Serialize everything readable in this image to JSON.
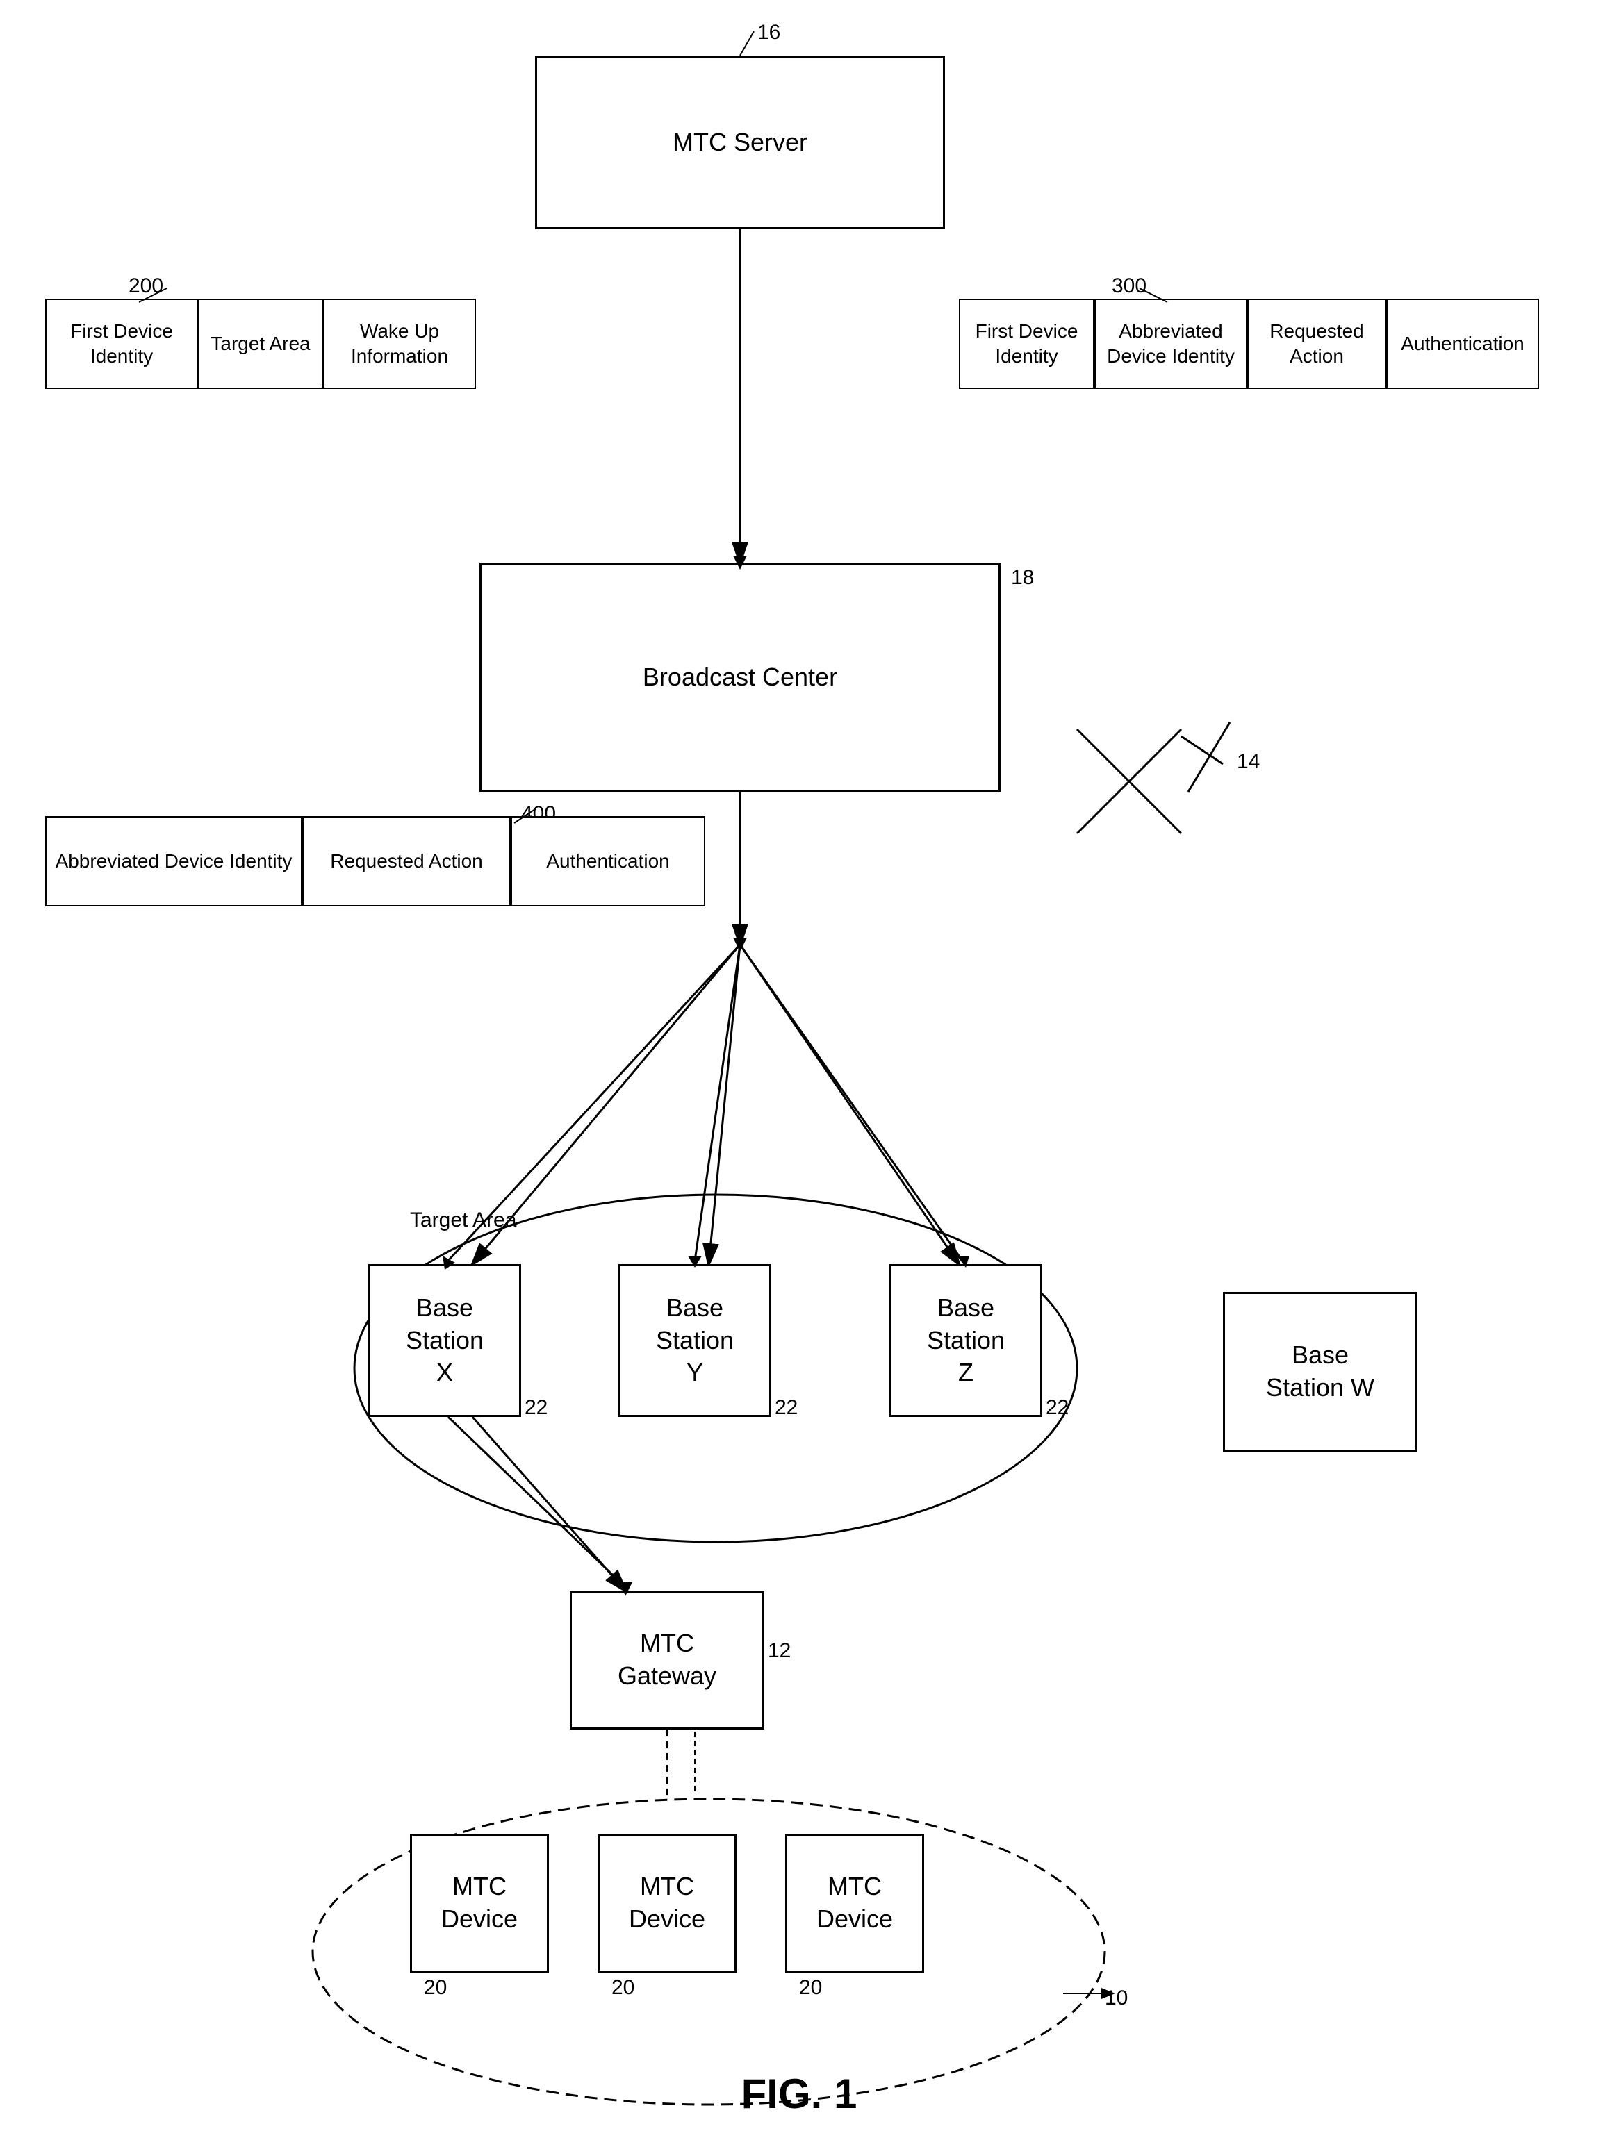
{
  "title": "FIG. 1",
  "nodes": {
    "mtc_server": {
      "label": "MTC Server",
      "ref": "16"
    },
    "broadcast_center": {
      "label": "Broadcast Center",
      "ref": "18"
    },
    "mtc_gateway": {
      "label": "MTC\nGateway",
      "ref": "12"
    },
    "base_station_x": {
      "label": "Base\nStation\nX",
      "ref": "22"
    },
    "base_station_y": {
      "label": "Base\nStation\nY",
      "ref": "22"
    },
    "base_station_z": {
      "label": "Base\nStation\nZ",
      "ref": "22"
    },
    "base_station_w": {
      "label": "Base\nStation W",
      "ref": ""
    },
    "mtc_device_1": {
      "label": "MTC\nDevice",
      "ref": "20"
    },
    "mtc_device_2": {
      "label": "MTC\nDevice",
      "ref": "20"
    },
    "mtc_device_3": {
      "label": "MTC\nDevice",
      "ref": "20"
    }
  },
  "message_200": {
    "ref": "200",
    "fields": [
      "First Device\nIdentity",
      "Target Area",
      "Wake Up\nInformation"
    ]
  },
  "message_300": {
    "ref": "300",
    "fields": [
      "First Device\nIdentity",
      "Abbreviated\nDevice Identity",
      "Requested\nAction",
      "Authentication"
    ]
  },
  "message_400": {
    "ref": "400",
    "fields": [
      "Abbreviated Device Identity",
      "Requested Action",
      "Authentication"
    ]
  },
  "labels": {
    "target_area": "Target Area",
    "network_ref": "14",
    "fig": "FIG. 1"
  }
}
